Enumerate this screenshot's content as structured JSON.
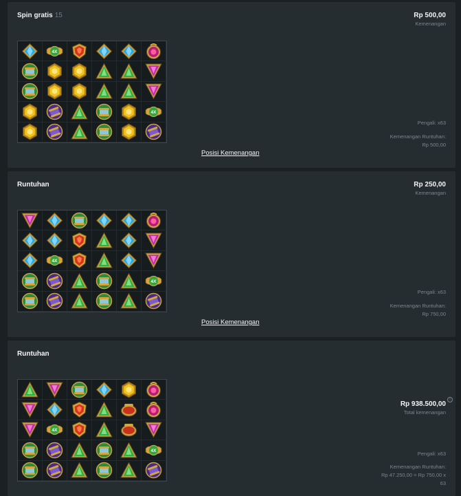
{
  "panels": [
    {
      "title": "Spin gratis",
      "count": "15",
      "amount": "Rp 500,00",
      "amount_label": "Kemenangan",
      "link": "Posisi Kemenangan",
      "multiplier": "Pengali: x63",
      "cascade_label": "Kemenangan Runtuhan:",
      "cascade_value": "Rp 500,00",
      "grid": [
        [
          "blue-diamond",
          "4x-winged-emblem",
          "red-shield",
          "blue-diamond",
          "blue-diamond",
          "pink-amulet"
        ],
        [
          "green-scroll",
          "yellow-hexagon",
          "yellow-hexagon",
          "green-triangle",
          "green-triangle",
          "magenta-triangle"
        ],
        [
          "green-scroll",
          "yellow-hexagon",
          "yellow-hexagon",
          "green-triangle",
          "green-triangle",
          "magenta-triangle"
        ],
        [
          "yellow-hexagon",
          "purple-scroll",
          "green-triangle",
          "green-scroll",
          "yellow-hexagon",
          "4x-winged-emblem"
        ],
        [
          "yellow-hexagon",
          "purple-scroll",
          "green-triangle",
          "green-scroll",
          "yellow-hexagon",
          "purple-scroll"
        ]
      ]
    },
    {
      "title": "Runtuhan",
      "amount": "Rp 250,00",
      "amount_label": "Kemenangan",
      "link": "Posisi Kemenangan",
      "multiplier": "Pengali: x63",
      "cascade_label": "Kemenangan Runtuhan:",
      "cascade_value": "Rp 750,00",
      "grid": [
        [
          "magenta-triangle",
          "blue-diamond",
          "green-scroll",
          "blue-diamond",
          "blue-diamond",
          "pink-amulet"
        ],
        [
          "blue-diamond",
          "blue-diamond",
          "red-shield",
          "green-triangle",
          "blue-diamond",
          "magenta-triangle"
        ],
        [
          "blue-diamond",
          "4x-winged-emblem",
          "red-shield",
          "green-triangle",
          "blue-diamond",
          "magenta-triangle"
        ],
        [
          "green-scroll",
          "purple-scroll",
          "green-triangle",
          "green-scroll",
          "green-triangle",
          "4x-winged-emblem"
        ],
        [
          "green-scroll",
          "purple-scroll",
          "green-triangle",
          "green-scroll",
          "green-triangle",
          "purple-scroll"
        ]
      ]
    },
    {
      "title": "Runtuhan",
      "total_amount": "Rp 938.500,00",
      "total_label": "Total kemenangan",
      "info_icon": "info-icon",
      "multiplier": "Pengali: x63",
      "cascade_label": "Kemenangan Runtuhan:",
      "cascade_value": "Rp 47.250,00 = Rp 750,00 x 63",
      "grid": [
        [
          "green-triangle",
          "magenta-triangle",
          "green-scroll",
          "blue-diamond",
          "yellow-hexagon",
          "pink-amulet"
        ],
        [
          "magenta-triangle",
          "blue-diamond",
          "red-shield",
          "green-triangle",
          "red-lamp",
          "pink-amulet"
        ],
        [
          "magenta-triangle",
          "4x-winged-emblem",
          "red-shield",
          "green-triangle",
          "red-lamp",
          "magenta-triangle"
        ],
        [
          "green-scroll",
          "purple-scroll",
          "green-triangle",
          "green-scroll",
          "green-triangle",
          "4x-winged-emblem"
        ],
        [
          "green-scroll",
          "purple-scroll",
          "green-triangle",
          "green-scroll",
          "green-triangle",
          "purple-scroll"
        ]
      ]
    }
  ],
  "symbol_badge_text": "4X",
  "colors": {
    "background": "#1b2023",
    "panel": "#262d31",
    "text": "#f2f4f5",
    "muted": "#7a868c"
  }
}
